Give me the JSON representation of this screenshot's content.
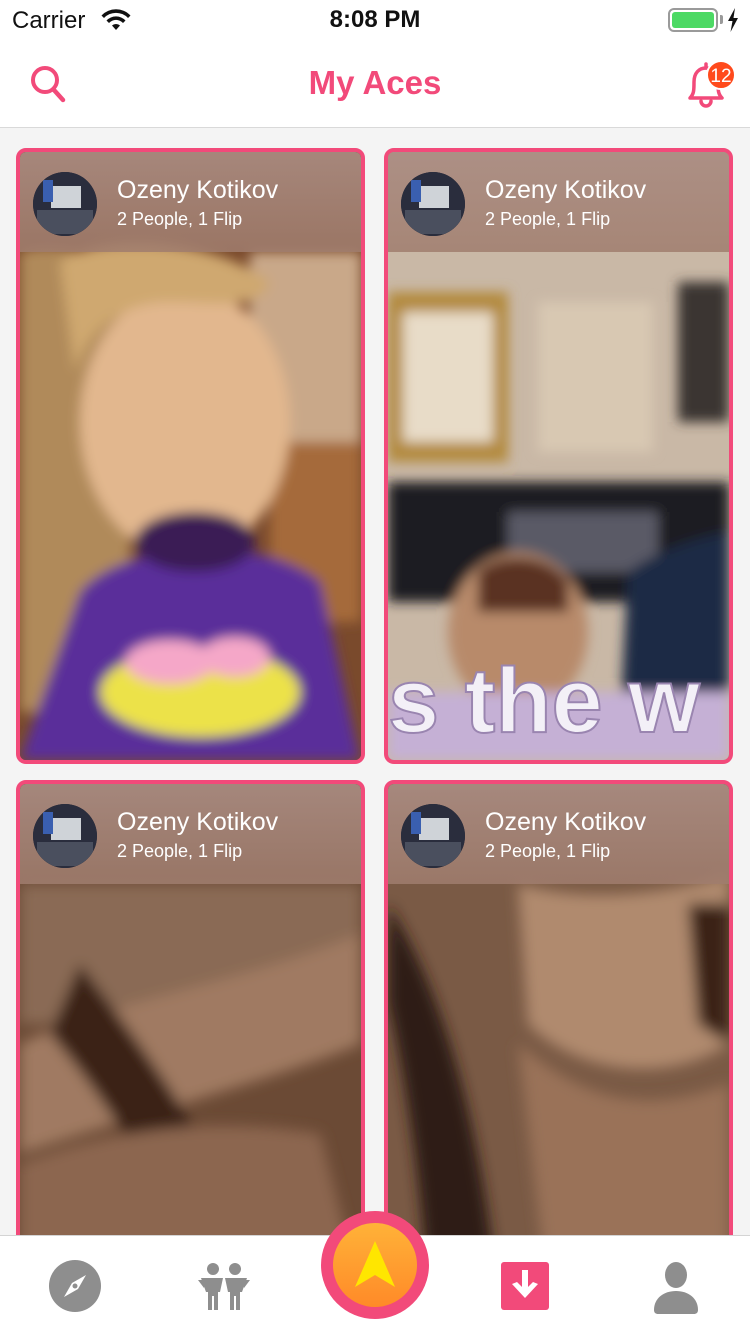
{
  "status_bar": {
    "carrier": "Carrier",
    "time": "8:08 PM"
  },
  "nav": {
    "title": "My Aces",
    "notification_count": "12"
  },
  "cards": [
    {
      "name": "Ozeny Kotikov",
      "subtitle": "2 People, 1 Flip"
    },
    {
      "name": "Ozeny Kotikov",
      "subtitle": "2 People, 1 Flip"
    },
    {
      "name": "Ozeny Kotikov",
      "subtitle": "2 People, 1 Flip"
    },
    {
      "name": "Ozeny Kotikov",
      "subtitle": "2 People, 1 Flip"
    }
  ],
  "photo_caption": "s the w",
  "tabbar": {
    "tabs": [
      "compass-icon",
      "people-icon",
      "ace-icon",
      "download-icon",
      "profile-icon"
    ],
    "active": "download-icon"
  },
  "colors": {
    "accent": "#f24a7a",
    "badge": "#ff4a1c",
    "center_button": "#ff9a2c",
    "arrow": "#ffe600"
  }
}
